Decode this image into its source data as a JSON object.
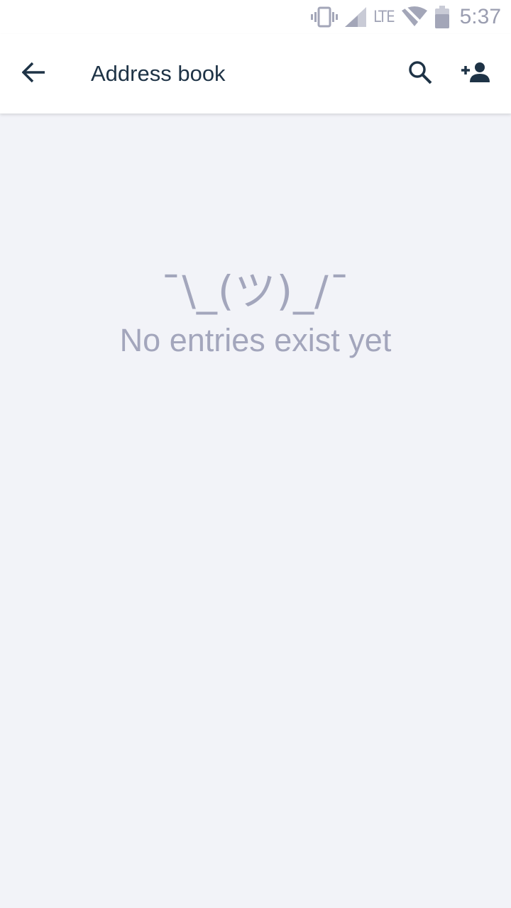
{
  "status_bar": {
    "network_label": "LTE",
    "time": "5:37",
    "icons": [
      "vibrate-icon",
      "signal-icon",
      "wifi-off-icon",
      "battery-icon"
    ]
  },
  "app_bar": {
    "title": "Address book",
    "back_icon": "arrow-back-icon",
    "search_icon": "search-icon",
    "add_icon": "person-add-icon"
  },
  "empty_state": {
    "emoticon": "¯\\_(ツ)_/¯",
    "message": "No entries exist yet"
  },
  "colors": {
    "background": "#f2f3f8",
    "app_bar": "#ffffff",
    "primary_text": "#1e3346",
    "muted_text": "#a3a6bc"
  }
}
